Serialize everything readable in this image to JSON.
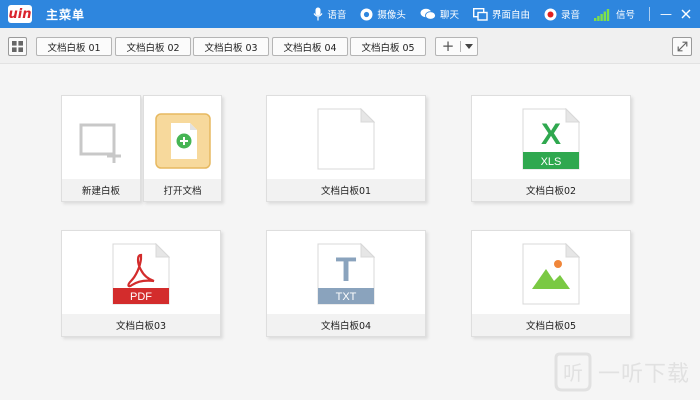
{
  "app": {
    "logo_text": "uin",
    "title": "主菜单"
  },
  "toolbar": {
    "voice_label": "语音",
    "camera_label": "摄像头",
    "chat_label": "聊天",
    "freedom_label": "界面自由",
    "record_label": "录音",
    "signal_label": "信号",
    "minimize_glyph": "—",
    "colors": {
      "bar": "#2e86de",
      "record": "#e02020",
      "signal": "#7ee04a"
    }
  },
  "tabs": [
    {
      "label": "文档白板 01"
    },
    {
      "label": "文档白板 02"
    },
    {
      "label": "文档白板 03"
    },
    {
      "label": "文档白板 04"
    },
    {
      "label": "文档白板 05"
    }
  ],
  "add_button": {
    "plus": "+"
  },
  "cards": {
    "new_board": {
      "label": "新建白板"
    },
    "open_doc": {
      "label": "打开文档"
    },
    "doc01": {
      "label": "文档白板01",
      "icon": "blank-document-icon"
    },
    "doc02": {
      "label": "文档白板02",
      "icon": "xls-document-icon",
      "badge": "XLS",
      "letter": "X",
      "color": "#2fa84f"
    },
    "doc03": {
      "label": "文档白板03",
      "icon": "pdf-document-icon",
      "badge": "PDF",
      "color": "#d32c2c"
    },
    "doc04": {
      "label": "文档白板04",
      "icon": "txt-document-icon",
      "badge": "TXT",
      "letter": "T",
      "color": "#8aa3bd"
    },
    "doc05": {
      "label": "文档白板05",
      "icon": "image-document-icon",
      "color": "#7ac943"
    }
  },
  "watermark": {
    "text": "一听下载"
  }
}
